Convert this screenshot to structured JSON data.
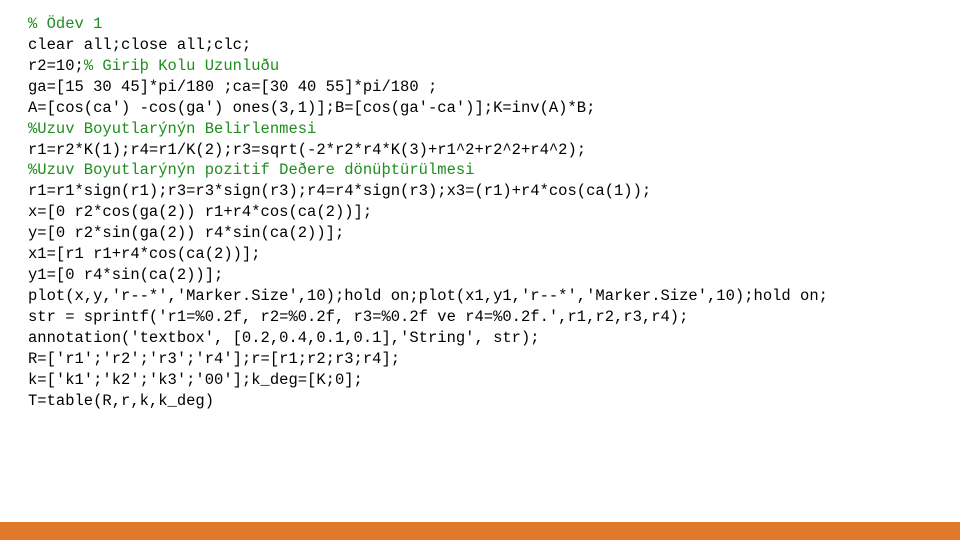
{
  "code": {
    "l1": "% Ödev 1",
    "l2": "clear all;close all;clc;",
    "l3a": "r2=10;",
    "l3b": "% Giriþ Kolu Uzunluðu",
    "l4": "ga=[15 30 45]*pi/180 ;ca=[30 40 55]*pi/180 ;",
    "l5": "A=[cos(ca') -cos(ga') ones(3,1)];B=[cos(ga'-ca')];K=inv(A)*B;",
    "l6": "%Uzuv Boyutlarýnýn Belirlenmesi",
    "l7": "r1=r2*K(1);r4=r1/K(2);r3=sqrt(-2*r2*r4*K(3)+r1^2+r2^2+r4^2);",
    "l8": "%Uzuv Boyutlarýnýn pozitif Deðere dönüþtürülmesi",
    "l9": "r1=r1*sign(r1);r3=r3*sign(r3);r4=r4*sign(r3);x3=(r1)+r4*cos(ca(1));",
    "l10": "x=[0 r2*cos(ga(2)) r1+r4*cos(ca(2))];",
    "l11": "y=[0 r2*sin(ga(2)) r4*sin(ca(2))];",
    "l12": "x1=[r1 r1+r4*cos(ca(2))];",
    "l13": "y1=[0 r4*sin(ca(2))];",
    "l14": "plot(x,y,'r--*','Marker.Size',10);hold on;plot(x1,y1,'r--*','Marker.Size',10);hold on;",
    "l15": "str = sprintf('r1=%0.2f, r2=%0.2f, r3=%0.2f ve r4=%0.2f.',r1,r2,r3,r4);",
    "l16": "annotation('textbox', [0.2,0.4,0.1,0.1],'String', str);",
    "l17": "R=['r1';'r2';'r3';'r4'];r=[r1;r2;r3;r4];",
    "l18": "k=['k1';'k2';'k3';'00'];k_deg=[K;0];",
    "l19": "T=table(R,r,k,k_deg)"
  },
  "colors": {
    "comment": "#1e8e1e",
    "footer": "#e07a2a"
  }
}
